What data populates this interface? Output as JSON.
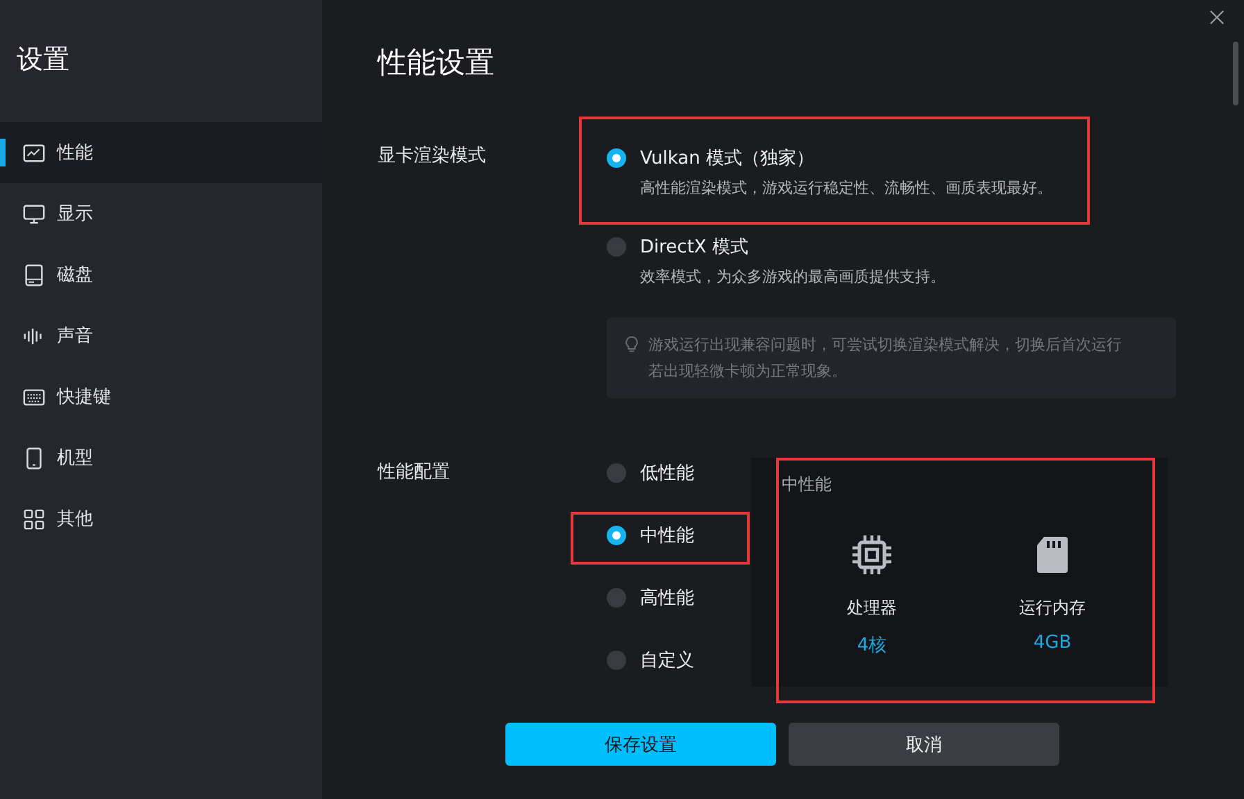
{
  "sidebar": {
    "title": "设置",
    "items": [
      {
        "label": "性能",
        "selected": true
      },
      {
        "label": "显示",
        "selected": false
      },
      {
        "label": "磁盘",
        "selected": false
      },
      {
        "label": "声音",
        "selected": false
      },
      {
        "label": "快捷键",
        "selected": false
      },
      {
        "label": "机型",
        "selected": false
      },
      {
        "label": "其他",
        "selected": false
      }
    ]
  },
  "page_title": "性能设置",
  "render_mode": {
    "label": "显卡渲染模式",
    "options": [
      {
        "label": "Vulkan 模式（独家）",
        "description": "高性能渲染模式，游戏运行稳定性、流畅性、画质表现最好。",
        "selected": true,
        "highlighted": true
      },
      {
        "label": "DirectX 模式",
        "description": "效率模式，为众多游戏的最高画质提供支持。",
        "selected": false,
        "highlighted": false
      }
    ],
    "tip": "游戏运行出现兼容问题时，可尝试切换渲染模式解决，切换后首次运行若出现轻微卡顿为正常现象。"
  },
  "performance": {
    "label": "性能配置",
    "options": [
      {
        "label": "低性能",
        "selected": false,
        "highlighted": false
      },
      {
        "label": "中性能",
        "selected": true,
        "highlighted": true
      },
      {
        "label": "高性能",
        "selected": false,
        "highlighted": false
      },
      {
        "label": "自定义",
        "selected": false,
        "highlighted": false
      }
    ],
    "panel": {
      "title": "中性能",
      "highlighted": true,
      "specs": [
        {
          "kind": "cpu",
          "label": "处理器",
          "value": "4核"
        },
        {
          "kind": "memory",
          "label": "运行内存",
          "value": "4GB"
        }
      ]
    }
  },
  "buttons": [
    {
      "label": "保存设置",
      "kind": "primary"
    },
    {
      "label": "取消",
      "kind": "secondary"
    }
  ]
}
